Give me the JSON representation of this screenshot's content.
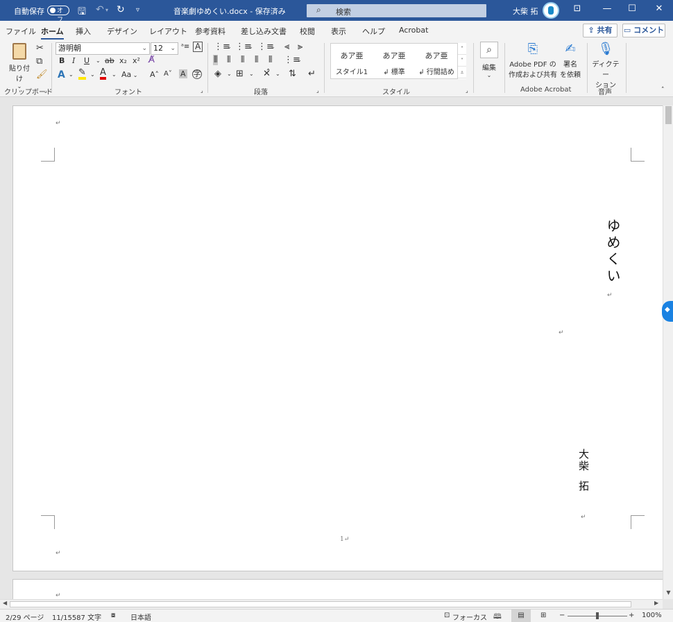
{
  "titlebar": {
    "autosave_label": "自動保存",
    "autosave_state": "オフ",
    "doc_title": "音楽劇ゆめくい.docx - 保存済み",
    "search_placeholder": "検索",
    "user_name": "大柴 拓",
    "icons": {
      "save": "save-icon",
      "undo": "undo-icon",
      "redo": "redo-icon",
      "customize": "customize-qat-icon"
    }
  },
  "tabs": [
    "ファイル",
    "ホーム",
    "挿入",
    "デザイン",
    "レイアウト",
    "参考資料",
    "差し込み文書",
    "校閲",
    "表示",
    "ヘルプ",
    "Acrobat"
  ],
  "active_tab": "ホーム",
  "share_label": "共有",
  "comment_label": "コメント",
  "ribbon": {
    "clipboard": {
      "paste_label": "貼り付け",
      "group_label": "クリップボード"
    },
    "font": {
      "font_name": "游明朝",
      "font_size": "12",
      "group_label": "フォント",
      "aa_label": "Aa"
    },
    "paragraph": {
      "group_label": "段落"
    },
    "styles": {
      "items": [
        {
          "sample": "あア亜",
          "name": "スタイル1"
        },
        {
          "sample": "あア亜",
          "name": "↲ 標準"
        },
        {
          "sample": "あア亜",
          "name": "↲ 行間詰め"
        }
      ],
      "group_label": "スタイル"
    },
    "editing": {
      "label": "編集"
    },
    "acrobat": {
      "create_pdf_line1": "Adobe PDF の",
      "create_pdf_line2": "作成および共有",
      "sign_line1": "署名",
      "sign_line2": "を依頼",
      "group_label": "Adobe Acrobat"
    },
    "voice": {
      "dictate_line1": "ディクテー",
      "dictate_line2": "ション",
      "group_label": "音声"
    }
  },
  "document": {
    "title_vertical": "ゆめくい",
    "author_vertical_1": "大柴",
    "author_vertical_2": "拓",
    "page_number": "1",
    "para_mark": "↵",
    "para_mark_v": "↵"
  },
  "statusbar": {
    "page": "2/29 ページ",
    "words": "11/15587 文字",
    "language": "日本語",
    "focus": "フォーカス",
    "zoom": "100%",
    "zoom_minus": "−",
    "zoom_plus": "+",
    "zoom_level": 0.5
  }
}
